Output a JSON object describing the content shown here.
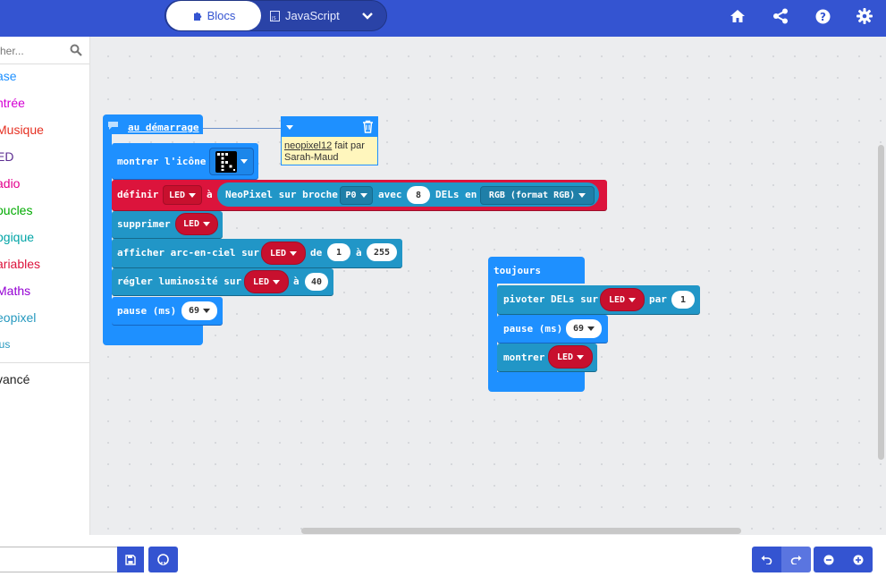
{
  "header": {
    "tabs": [
      {
        "label": "Blocs",
        "active": true
      },
      {
        "label": "JavaScript",
        "active": false
      }
    ],
    "icons": [
      "home-icon",
      "share-icon",
      "help-icon",
      "settings-icon"
    ]
  },
  "toolbox": {
    "search_placeholder": "cher...",
    "categories": [
      {
        "label": "ase",
        "color": "#1e90ff"
      },
      {
        "label": "ntrée",
        "color": "#d400d4"
      },
      {
        "label": "Musique",
        "color": "#e63022"
      },
      {
        "label": "ED",
        "color": "#5c2d91"
      },
      {
        "label": "adio",
        "color": "#e3008c"
      },
      {
        "label": "oucles",
        "color": "#00aa00"
      },
      {
        "label": "ogique",
        "color": "#00a4a6"
      },
      {
        "label": "ariables",
        "color": "#dc143c"
      },
      {
        "label": "Maths",
        "color": "#9400d3"
      },
      {
        "label": "eopixel",
        "color": "#2699bf"
      },
      {
        "label": "lus",
        "color": "#2699bf"
      }
    ],
    "advanced": "vancé"
  },
  "workspace": {
    "on_start": {
      "label": "au démarrage",
      "show_icon": "montrer l'icône",
      "set": {
        "label": "définir",
        "var": "LED",
        "to": "à",
        "neopixel": "NeoPixel sur broche",
        "pin": "P0",
        "with": "avec",
        "count": "8",
        "leds_in": "DELs en",
        "mode": "RGB (format RGB)"
      },
      "clear": {
        "label": "supprimer",
        "var": "LED"
      },
      "rainbow": {
        "label": "afficher arc-en-ciel sur",
        "var": "LED",
        "from": "de",
        "start": "1",
        "to": "à",
        "end": "255"
      },
      "brightness": {
        "label": "régler luminosité sur",
        "var": "LED",
        "to": "à",
        "value": "40"
      },
      "pause": {
        "label": "pause (ms)",
        "value": "69"
      }
    },
    "forever": {
      "label": "toujours",
      "rotate": {
        "label": "pivoter DELs sur",
        "var": "LED",
        "by": "par",
        "value": "1"
      },
      "pause": {
        "label": "pause (ms)",
        "value": "69"
      },
      "show": {
        "label": "montrer",
        "var": "LED"
      }
    },
    "comment": {
      "link": "neopixel12",
      "text": " fait par Sarah-Maud"
    }
  },
  "colors": {
    "topbar": "#3454d1",
    "basic": "#1e90ff",
    "variables": "#dc143c",
    "neopixel": "#2196c7"
  }
}
